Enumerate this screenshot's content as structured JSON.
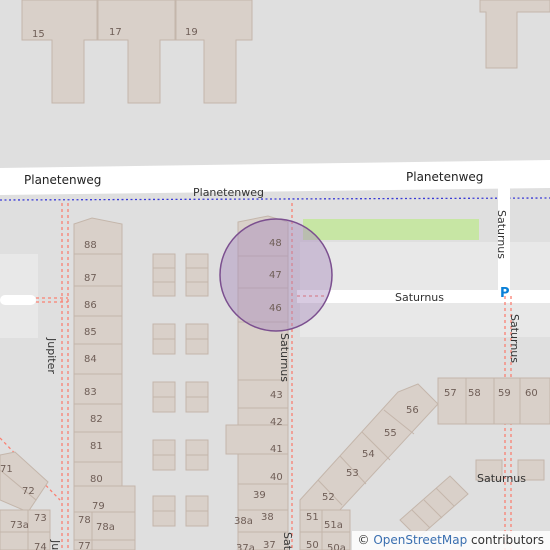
{
  "streets": {
    "planetenweg_main": "Planetenweg",
    "planetenweg_main_right": "Planetenweg",
    "planetenweg_path": "Planetenweg",
    "saturnus_north": "Saturnus",
    "saturnus_east": "Saturnus",
    "saturnus_south_right": "Saturnus",
    "saturnus_west_vertical": "Saturnus",
    "saturnus_bottom": "Saturnus",
    "saturnus_cut": "Sat",
    "jupiter": "Jupiter",
    "jupiter_cut": "Ju"
  },
  "parking": {
    "symbol": "P",
    "color": "#0a80d8"
  },
  "colors": {
    "background": "#dfdfdf",
    "building_fill": "#d9d0c9",
    "building_stroke": "#c4b6ab",
    "road": "#ffffff",
    "grass": "#c7e6a4",
    "footpath_dash": "#fa8072",
    "boundary": "#3b3bd6",
    "marker_fill": "#a98bbd",
    "marker_stroke": "#7b4f8f"
  },
  "house_numbers": {
    "top": [
      "15",
      "17",
      "19"
    ],
    "left_row": [
      "88",
      "87",
      "86",
      "85",
      "84",
      "83",
      "82",
      "81",
      "80",
      "79",
      "78",
      "78a",
      "77"
    ],
    "center_row": [
      "48",
      "47",
      "46",
      "43",
      "42",
      "41",
      "40",
      "39",
      "38",
      "38a",
      "37",
      "37a"
    ],
    "far_left": [
      "71",
      "72",
      "73",
      "73a",
      "74"
    ],
    "lower_right": [
      "56",
      "55",
      "54",
      "53",
      "52",
      "51",
      "51a",
      "50",
      "50a",
      "57",
      "58",
      "59",
      "60"
    ]
  },
  "attribution": {
    "prefix": "© ",
    "link": "OpenStreetMap",
    "suffix": " contributors"
  }
}
